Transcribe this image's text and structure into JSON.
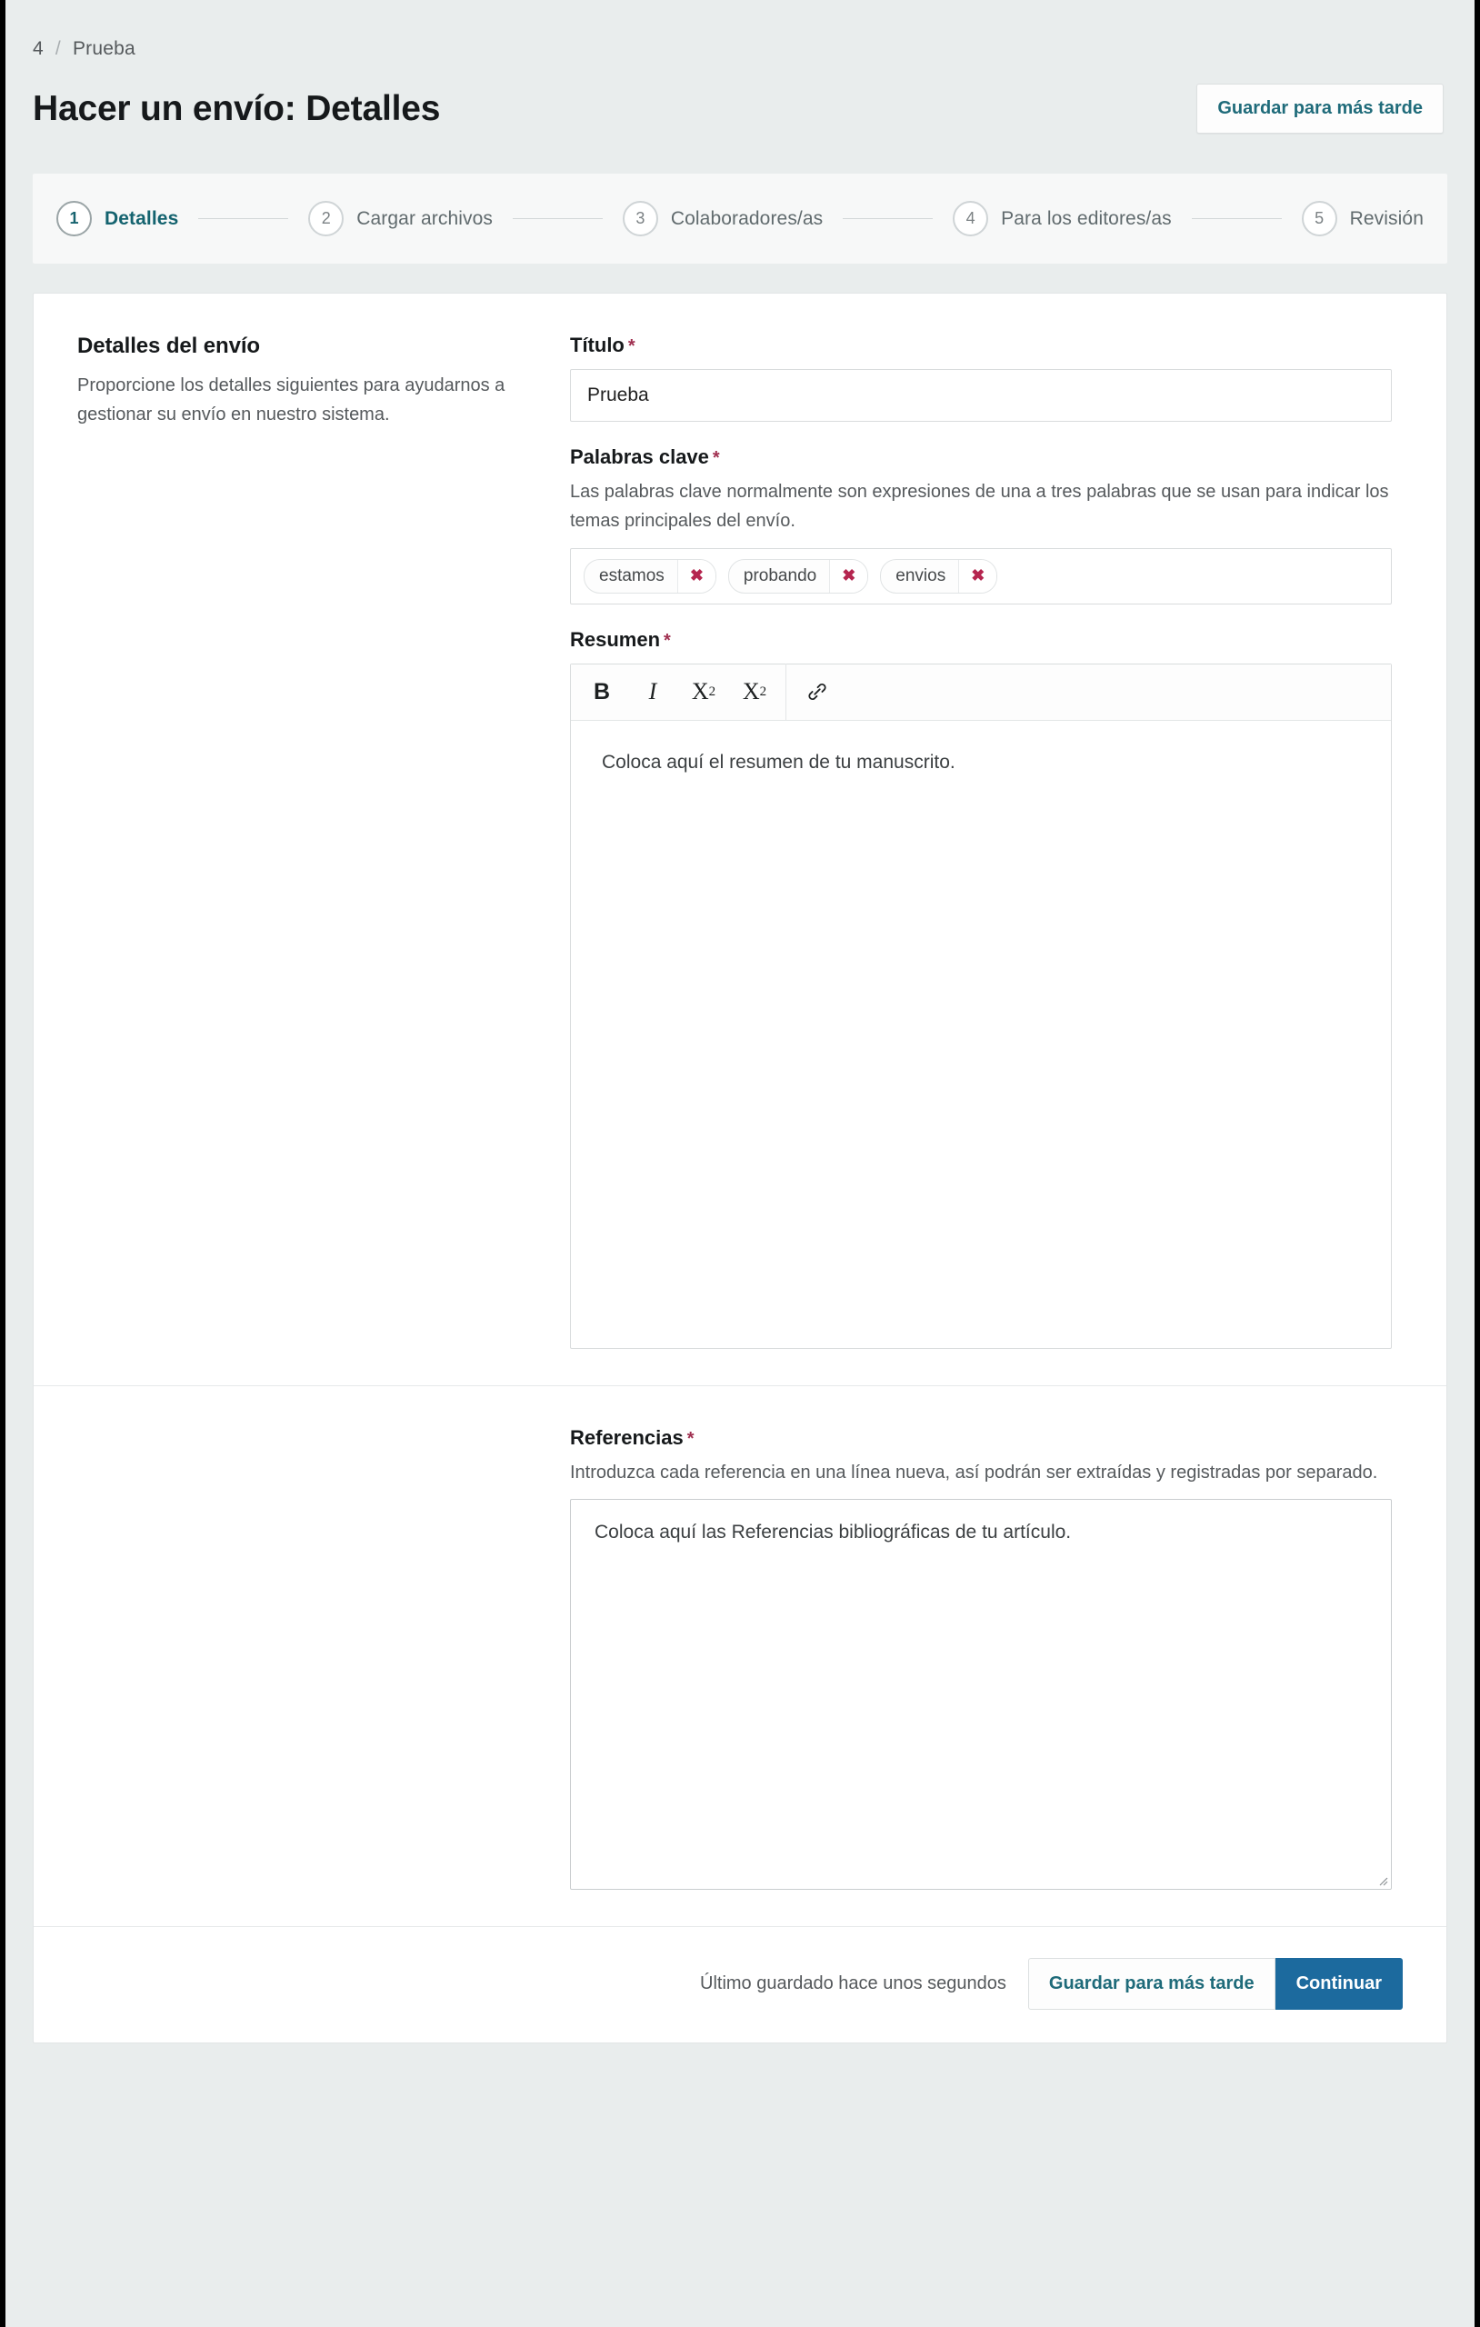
{
  "breadcrumb": {
    "id": "4",
    "separator": "/",
    "current": "Prueba"
  },
  "header": {
    "title": "Hacer un envío: Detalles",
    "save_later_label": "Guardar para más tarde"
  },
  "stepper": {
    "steps": [
      {
        "num": "1",
        "label": "Detalles",
        "active": true
      },
      {
        "num": "2",
        "label": "Cargar archivos",
        "active": false
      },
      {
        "num": "3",
        "label": "Colaboradores/as",
        "active": false
      },
      {
        "num": "4",
        "label": "Para los editores/as",
        "active": false
      },
      {
        "num": "5",
        "label": "Revisión",
        "active": false
      }
    ]
  },
  "sidebar": {
    "title": "Detalles del envío",
    "description": "Proporcione los detalles siguientes para ayudarnos a gestionar su envío en nuestro sistema."
  },
  "form": {
    "title_field": {
      "label": "Título",
      "required_mark": "*",
      "value": "Prueba",
      "placeholder": ""
    },
    "keywords_field": {
      "label": "Palabras clave",
      "required_mark": "*",
      "help": "Las palabras clave normalmente son expresiones de una a tres palabras que se usan para indicar los temas principales del envío.",
      "chips": [
        {
          "text": "estamos",
          "remove_glyph": "✖"
        },
        {
          "text": "probando",
          "remove_glyph": "✖"
        },
        {
          "text": "envios",
          "remove_glyph": "✖"
        }
      ]
    },
    "abstract_field": {
      "label": "Resumen",
      "required_mark": "*",
      "toolbar": [
        {
          "name": "bold",
          "glyph": "B"
        },
        {
          "name": "italic",
          "glyph": "I"
        },
        {
          "name": "superscript",
          "glyph": "X",
          "script": "2"
        },
        {
          "name": "subscript",
          "glyph": "X",
          "script": "2"
        },
        {
          "name": "link",
          "glyph": "🔗"
        }
      ],
      "content": "Coloca aquí el resumen de tu manuscrito."
    },
    "references_field": {
      "label": "Referencias",
      "required_mark": "*",
      "help": "Introduzca cada referencia en una línea nueva, así podrán ser extraídas y registradas por separado.",
      "content": "Coloca aquí las Referencias bibliográficas de tu artículo."
    }
  },
  "footer": {
    "saved_status": "Último guardado hace unos segundos",
    "save_later_label": "Guardar para más tarde",
    "continue_label": "Continuar"
  },
  "colors": {
    "accent_teal": "#14636f",
    "primary_blue": "#1c6a9e",
    "required_red": "#a03050",
    "chip_remove_red": "#b5254f",
    "page_bg": "#e9eded",
    "card_bg": "#ffffff"
  }
}
